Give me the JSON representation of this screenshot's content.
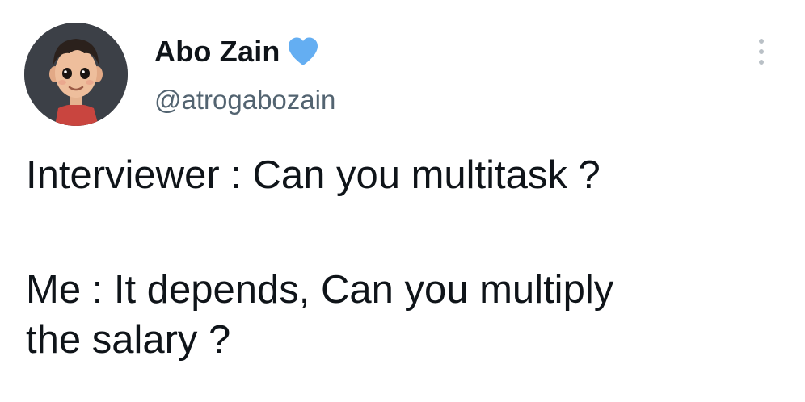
{
  "author": {
    "display_name": "Abo Zain",
    "handle": "@atrogabozain",
    "verified_color": "#64aef2"
  },
  "icons": {
    "avatar": "cartoon-boy-avatar",
    "badge": "blue-heart-icon",
    "menu": "more-options-vertical-dots-icon"
  },
  "tweet": {
    "line1": "Interviewer : Can you multitask ?",
    "line2": "Me : It depends, Can you multiply\nthe salary ?"
  }
}
